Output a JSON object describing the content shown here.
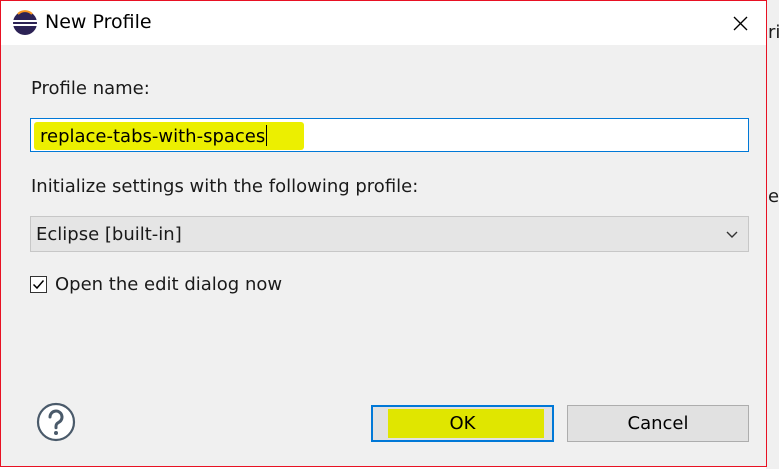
{
  "background_window": {
    "fragments": [
      "ri",
      "e"
    ]
  },
  "dialog": {
    "title": "New Profile",
    "app_icon": "eclipse-icon",
    "close_icon": "close-icon"
  },
  "form": {
    "profile_name_label": "Profile name:",
    "profile_name_value": "replace-tabs-with-spaces",
    "init_label": "Initialize settings with the following profile:",
    "init_selected": "Eclipse [built-in]",
    "open_edit_label": "Open the edit dialog now",
    "open_edit_checked": true
  },
  "buttons": {
    "help_icon": "help-icon",
    "ok_label": "OK",
    "cancel_label": "Cancel"
  },
  "colors": {
    "accent": "#0078d7",
    "highlight": "#ecef00",
    "window_border": "#e81123"
  }
}
